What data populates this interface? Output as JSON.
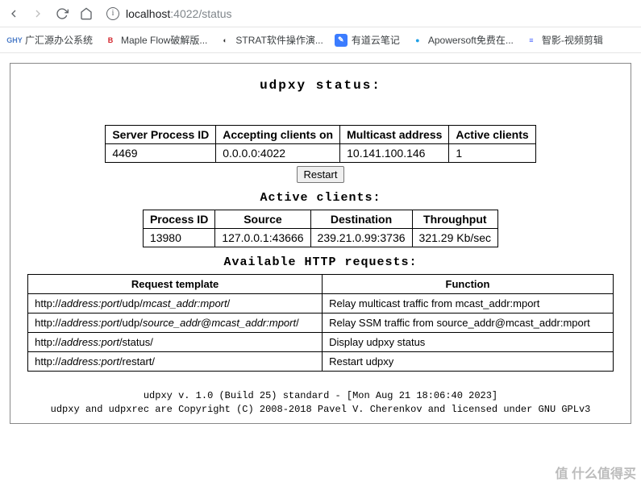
{
  "browser": {
    "url_host": "localhost",
    "url_port": ":4022",
    "url_path": "/status"
  },
  "bookmarks": [
    {
      "label": "广汇源办公系统",
      "icon_text": "GHY",
      "icon_bg": "#fff",
      "icon_color": "#4a7bc7"
    },
    {
      "label": "Maple Flow破解版...",
      "icon_text": "B",
      "icon_bg": "#fff",
      "icon_color": "#d2232a"
    },
    {
      "label": "STRAT软件操作演...",
      "icon_text": "◐",
      "icon_bg": "#fff",
      "icon_color": "#333"
    },
    {
      "label": "有道云笔记",
      "icon_text": "✎",
      "icon_bg": "#3b7cff",
      "icon_color": "#fff"
    },
    {
      "label": "Apowersoft免费在...",
      "icon_text": "●",
      "icon_bg": "#fff",
      "icon_color": "#1fa0e6"
    },
    {
      "label": "智影-视频剪辑",
      "icon_text": "≡",
      "icon_bg": "#fff",
      "icon_color": "#3d5afe"
    }
  ],
  "title": "udpxy status:",
  "server_table": {
    "headers": [
      "Server Process ID",
      "Accepting clients on",
      "Multicast address",
      "Active clients"
    ],
    "row": [
      "4469",
      "0.0.0.0:4022",
      "10.141.100.146",
      "1"
    ]
  },
  "restart_label": "Restart",
  "clients_title": "Active clients:",
  "clients_table": {
    "headers": [
      "Process ID",
      "Source",
      "Destination",
      "Throughput"
    ],
    "row": [
      "13980",
      "127.0.0.1:43666",
      "239.21.0.99:3736",
      "321.29 Kb/sec"
    ]
  },
  "requests_title": "Available HTTP requests:",
  "requests_table": {
    "headers": [
      "Request template",
      "Function"
    ],
    "rows": [
      {
        "tpl": "http://<em>address:port</em>/udp/<em>mcast_addr:mport</em>/",
        "func": "Relay multicast traffic from mcast_addr:mport"
      },
      {
        "tpl": "http://<em>address:port</em>/udp/<em>source_addr</em>@<em>mcast_addr:mport</em>/",
        "func": "Relay SSM traffic from source_addr@mcast_addr:mport"
      },
      {
        "tpl": "http://<em>address:port</em>/status/",
        "func": "Display udpxy status"
      },
      {
        "tpl": "http://<em>address:port</em>/restart/",
        "func": "Restart udpxy"
      }
    ]
  },
  "footer_line1": "udpxy v. 1.0 (Build 25) standard - [Mon Aug 21 18:06:40 2023]",
  "footer_line2": "udpxy and udpxrec are Copyright (C) 2008-2018 Pavel V. Cherenkov and licensed under GNU GPLv3",
  "watermark": "值 什么值得买"
}
